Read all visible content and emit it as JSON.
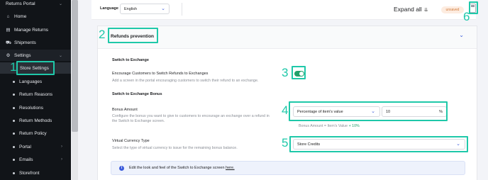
{
  "sidebar": {
    "top_item": "Returns Portal",
    "items": [
      {
        "label": "Home",
        "icon": "home-icon"
      },
      {
        "label": "Manage Returns",
        "icon": "clipboard-icon"
      },
      {
        "label": "Shipments",
        "icon": "truck-icon"
      },
      {
        "label": "Settings",
        "icon": "gear-icon"
      }
    ],
    "sub_items": [
      {
        "label": "Store Settings",
        "active": true
      },
      {
        "label": "Languages"
      },
      {
        "label": "Return Reasons"
      },
      {
        "label": "Resolutions"
      },
      {
        "label": "Return Methods"
      },
      {
        "label": "Return Policy"
      },
      {
        "label": "Portal",
        "has_children": true
      },
      {
        "label": "Emails",
        "has_children": true
      },
      {
        "label": "Storefront"
      }
    ]
  },
  "topbar": {
    "language_label": "Language",
    "language_value": "English",
    "expand_all": "Expand all",
    "unsaved": "unsaved"
  },
  "panel": {
    "title": "Refunds prevention",
    "exchange": {
      "section_title": "Switch to Exchange",
      "label": "Encourage Customers to Switch Refunds to Exchanges",
      "description": "Add a screen in the portal encouraging customers to switch their refund to an exchange.",
      "enabled": true
    },
    "bonus": {
      "section_title": "Switch to Exchange Bonus",
      "label": "Bonus Amount",
      "description_line1": "Configure the bonus you want to give to customers to encourage an exchange over a refund in",
      "description_line2": "the Switch to Exchange screen.",
      "type_value": "Percentage of item's value",
      "amount_value": "10",
      "amount_unit": "%",
      "hint_prefix": "Bonus Amount = Item's Value",
      "hint_accent": "+ 10%"
    },
    "currency": {
      "label": "Virtual Currency Type",
      "description": "Select the type of virtual currency to issue for the remaining bonus balance.",
      "value": "Store Credits"
    },
    "info": {
      "text": "Edit the look and feel of the Switch to Exchange screen",
      "link": "here."
    }
  },
  "annotations": [
    "1",
    "2",
    "3",
    "4",
    "5",
    "6"
  ],
  "colors": {
    "annotation": "#1fc8a9",
    "toggle_on": "#22a06b",
    "accent_blue": "#3b5bdb",
    "sidebar_bg": "#111418"
  }
}
